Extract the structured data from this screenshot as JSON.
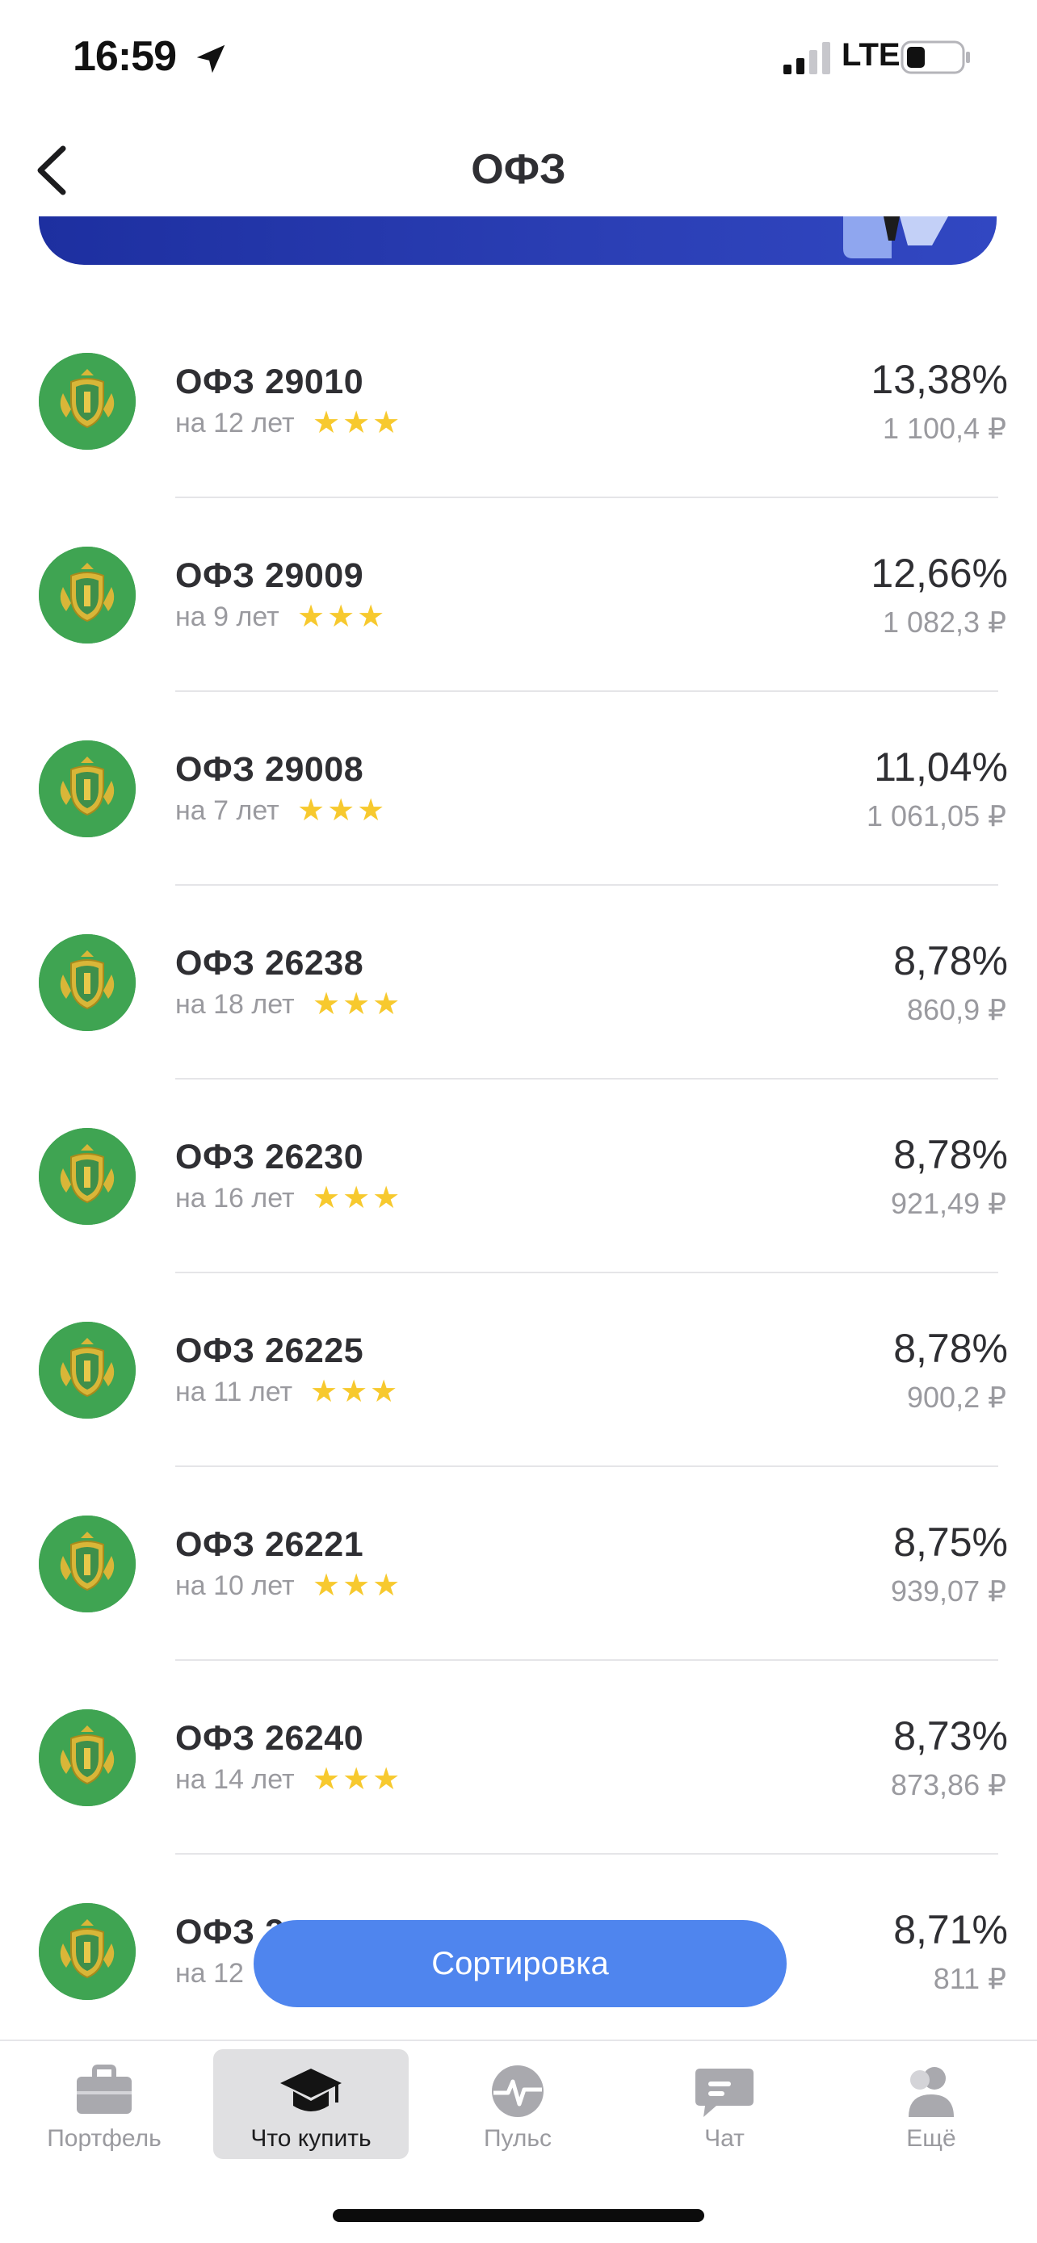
{
  "status_bar": {
    "time": "16:59",
    "network": "LTE",
    "icons": [
      "location-arrow-icon",
      "signal-icon",
      "battery-icon"
    ]
  },
  "header": {
    "title": "ОФЗ",
    "back_icon": "chevron-left-icon"
  },
  "colors": {
    "logo_bg": "#3fa452",
    "star": "#f7c92e",
    "sort_button": "#4f85ee",
    "banner": "#2b3fb5"
  },
  "bonds": [
    {
      "name": "ОФЗ 29010",
      "term": "на 12 лет",
      "rating": 3,
      "yield": "13,38%",
      "price": "1 100,4 ₽"
    },
    {
      "name": "ОФЗ 29009",
      "term": "на 9 лет",
      "rating": 3,
      "yield": "12,66%",
      "price": "1 082,3 ₽"
    },
    {
      "name": "ОФЗ 29008",
      "term": "на 7 лет",
      "rating": 3,
      "yield": "11,04%",
      "price": "1 061,05 ₽"
    },
    {
      "name": "ОФЗ 26238",
      "term": "на 18 лет",
      "rating": 3,
      "yield": "8,78%",
      "price": "860,9 ₽"
    },
    {
      "name": "ОФЗ 26230",
      "term": "на 16 лет",
      "rating": 3,
      "yield": "8,78%",
      "price": "921,49 ₽"
    },
    {
      "name": "ОФЗ 26225",
      "term": "на 11 лет",
      "rating": 3,
      "yield": "8,78%",
      "price": "900,2 ₽"
    },
    {
      "name": "ОФЗ 26221",
      "term": "на 10 лет",
      "rating": 3,
      "yield": "8,75%",
      "price": "939,07 ₽"
    },
    {
      "name": "ОФЗ 26240",
      "term": "на 14 лет",
      "rating": 3,
      "yield": "8,73%",
      "price": "873,86 ₽"
    },
    {
      "name": "ОФЗ 2",
      "term": "на 12",
      "rating": 0,
      "yield": "8,71%",
      "price": "811 ₽"
    }
  ],
  "sort_button": {
    "label": "Сортировка"
  },
  "tab_bar": {
    "items": [
      {
        "label": "Портфель",
        "icon": "briefcase-icon",
        "active": false
      },
      {
        "label": "Что купить",
        "icon": "graduation-cap-icon",
        "active": true
      },
      {
        "label": "Пульс",
        "icon": "pulse-icon",
        "active": false
      },
      {
        "label": "Чат",
        "icon": "chat-icon",
        "active": false
      },
      {
        "label": "Ещё",
        "icon": "profile-icon",
        "active": false
      }
    ]
  }
}
